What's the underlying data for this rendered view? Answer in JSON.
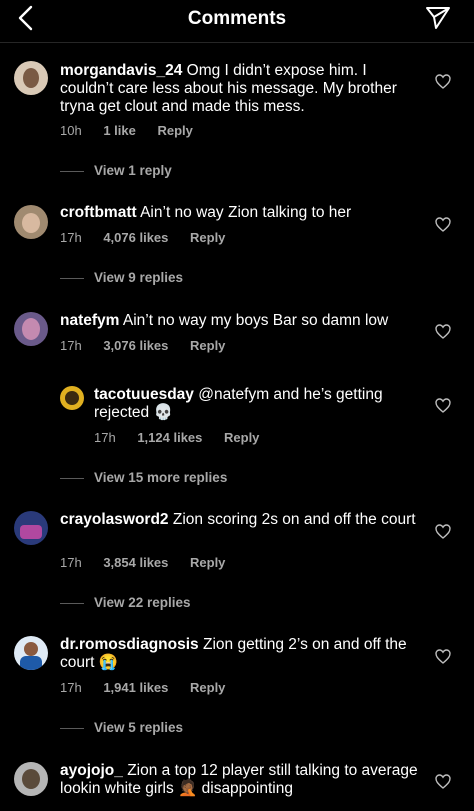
{
  "header": {
    "title": "Comments"
  },
  "comments": [
    {
      "username": "morgandavis_24",
      "text": "Omg I didn’t expose him. I couldn’t care less about his message. My brother tryna get clout and made this mess.",
      "time": "10h",
      "likes": "1 like",
      "reply": "Reply",
      "view_replies": "View 1 reply"
    },
    {
      "username": "croftbmatt",
      "text": "Ain’t no way Zion talking to her",
      "time": "17h",
      "likes": "4,076 likes",
      "reply": "Reply",
      "view_replies": "View 9 replies"
    },
    {
      "username": "natefym",
      "text": "Ain’t no way my boys Bar so damn low",
      "time": "17h",
      "likes": "3,076 likes",
      "reply": "Reply"
    },
    {
      "username": "tacotuuesday",
      "text": "@natefym and he’s getting rejected 💀",
      "time": "17h",
      "likes": "1,124 likes",
      "reply": "Reply",
      "view_replies": "View 15 more replies"
    },
    {
      "username": "crayolasword2",
      "text": "Zion scoring 2s on and off the court",
      "time": "17h",
      "likes": "3,854 likes",
      "reply": "Reply",
      "view_replies": "View 22 replies"
    },
    {
      "username": "dr.romosdiagnosis",
      "text": "Zion getting 2’s on and off the court 😭",
      "time": "17h",
      "likes": "1,941 likes",
      "reply": "Reply",
      "view_replies": "View 5 replies"
    },
    {
      "username": "ayojojo_",
      "text": "Zion a top 12 player still talking to average lookin white girls 🤦🏾 disappointing"
    }
  ]
}
